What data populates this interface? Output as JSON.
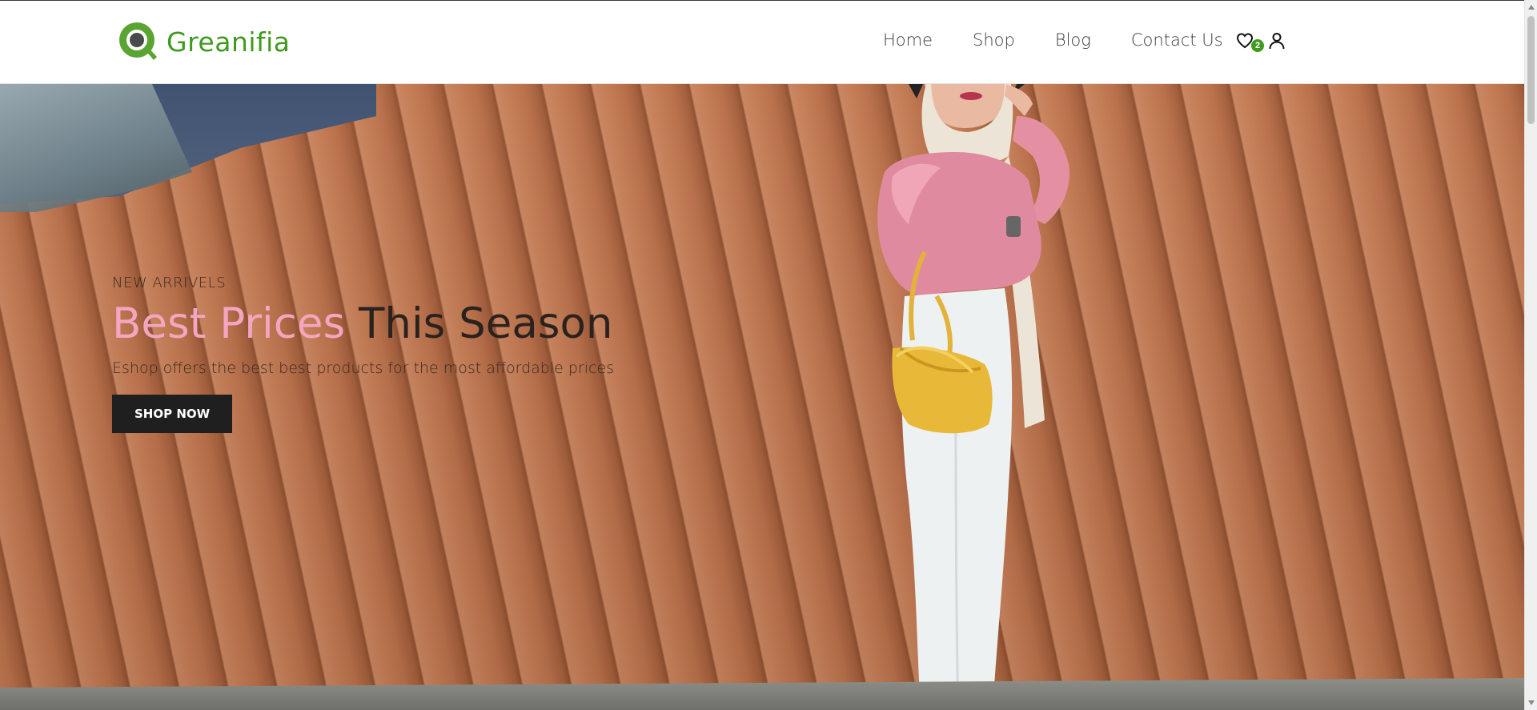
{
  "brand": {
    "name": "Greanifia",
    "color": "#3f9a1e"
  },
  "nav": {
    "items": [
      {
        "label": "Home"
      },
      {
        "label": "Shop"
      },
      {
        "label": "Blog"
      },
      {
        "label": "Contact Us"
      }
    ]
  },
  "header_icons": {
    "wishlist_icon": "heart-icon",
    "wishlist_count": "2",
    "account_icon": "user-icon"
  },
  "hero": {
    "kicker": "NEW ARRIVELS",
    "title_accent": "Best Prices",
    "title_rest": "This Season",
    "description": "Eshop offers the best best products for the most affordable prices",
    "button_label": "SHOP NOW",
    "accent_color": "#f4a6c0"
  }
}
